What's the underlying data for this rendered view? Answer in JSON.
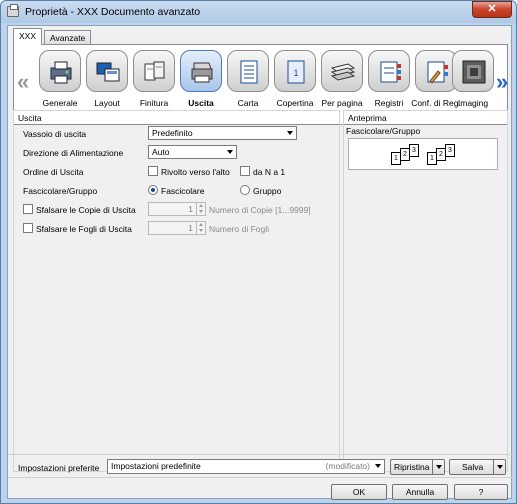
{
  "window": {
    "title": "Proprietà - XXX Documento avanzato",
    "close_label": "✕"
  },
  "tabs": [
    {
      "label": "XXX"
    },
    {
      "label": "Avanzate"
    }
  ],
  "categories": [
    {
      "label": "Generale",
      "icon": "general-printer-icon"
    },
    {
      "label": "Layout",
      "icon": "layout-icon"
    },
    {
      "label": "Finitura",
      "icon": "finishing-icon"
    },
    {
      "label": "Uscita",
      "icon": "output-icon",
      "selected": true
    },
    {
      "label": "Carta",
      "icon": "paper-icon"
    },
    {
      "label": "Copertina",
      "icon": "cover-icon"
    },
    {
      "label": "Per pagina",
      "icon": "per-page-icon"
    },
    {
      "label": "Registri",
      "icon": "registers-icon"
    },
    {
      "label": "Conf. di Reg.",
      "icon": "registry-config-icon"
    },
    {
      "label": "Imaging",
      "icon": "imaging-icon"
    }
  ],
  "nav": {
    "left": "«",
    "right": "»"
  },
  "uscita": {
    "group_title": "Uscita",
    "vassoio_label": "Vassoio di uscita",
    "vassoio_value": "Predefinito",
    "direzione_label": "Direzione di Alimentazione",
    "direzione_value": "Auto",
    "ordine_label": "Ordine di Uscita",
    "rivolto_label": "Rivolto verso l'alto",
    "dan1_label": "da N a 1",
    "fascicolare_gruppo_label": "Fascicolare/Gruppo",
    "fascicolare_option": "Fascicolare",
    "gruppo_option": "Gruppo",
    "sfalsare_copie_label": "Sfalsare le Copie di Uscita",
    "copie_value": "1",
    "copie_range_label": "Numero di Copie [1...9999]",
    "sfalsare_fogli_label": "Sfalsare le Fogli di Uscita",
    "fogli_value": "1",
    "fogli_label": "Numero di Fogli"
  },
  "anteprima": {
    "title": "Anteprima",
    "subtitle": "Fascicolare/Gruppo",
    "set1": [
      "1",
      "2",
      "3"
    ],
    "set2": [
      "1",
      "2",
      "3"
    ]
  },
  "footer": {
    "impostazioni_label": "Impostazioni preferite",
    "impostazioni_value": "Impostazioni predefinite",
    "modificato": "(modificato)",
    "ripristina": "Ripristina",
    "salva": "Salva",
    "ok": "OK",
    "annulla": "Annulla",
    "help": "?"
  }
}
